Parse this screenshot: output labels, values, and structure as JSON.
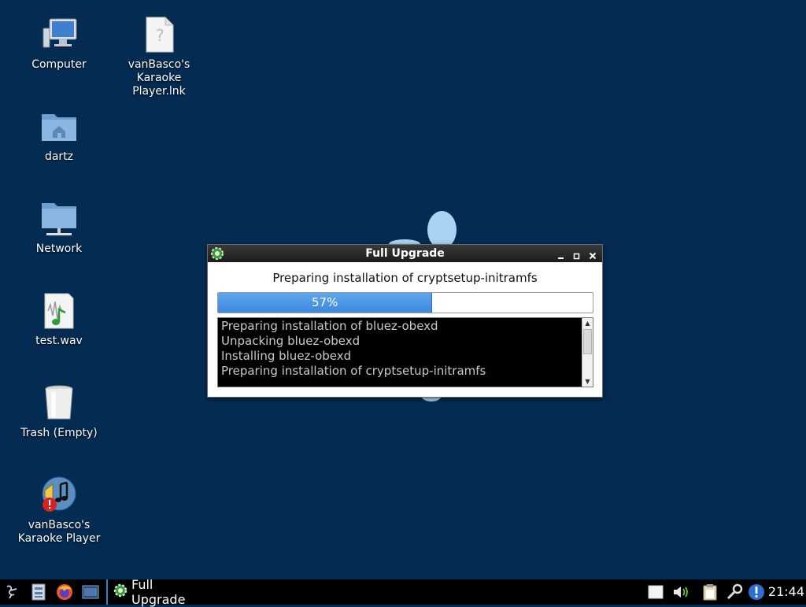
{
  "desktop": {
    "icons": [
      {
        "label": "Computer",
        "icon": "computer-icon"
      },
      {
        "label": "vanBasco's Karaoke Player.lnk",
        "icon": "shortcut-file-icon"
      },
      {
        "label": "dartz",
        "icon": "home-folder-icon"
      },
      {
        "label": "Network",
        "icon": "network-folder-icon"
      },
      {
        "label": "test.wav",
        "icon": "audio-file-icon"
      },
      {
        "label": "Trash (Empty)",
        "icon": "trash-icon"
      },
      {
        "label": "vanBasco's Karaoke Player",
        "icon": "karaoke-app-icon"
      }
    ]
  },
  "dialog": {
    "title": "Full Upgrade",
    "status": "Preparing installation of cryptsetup-initramfs",
    "progress": {
      "value": 57,
      "label": "57%"
    },
    "log": [
      "Preparing installation of bluez-obexd",
      "Unpacking bluez-obexd",
      "Installing bluez-obexd",
      "Preparing installation of cryptsetup-initramfs"
    ],
    "buttons": [
      "minimize",
      "maximize",
      "close"
    ]
  },
  "taskbar": {
    "launchers": [
      "start-menu-icon",
      "file-manager-icon",
      "firefox-icon",
      "terminal-icon"
    ],
    "task": "Full Upgrade",
    "tray": [
      "notes-icon",
      "volume-icon",
      "clipboard-icon",
      "network-tool-icon",
      "update-notifier-icon"
    ],
    "clock": "21:44"
  },
  "colors": {
    "desktop": "#042b52",
    "progress": "#3d88de",
    "taskbar": "#000000"
  }
}
